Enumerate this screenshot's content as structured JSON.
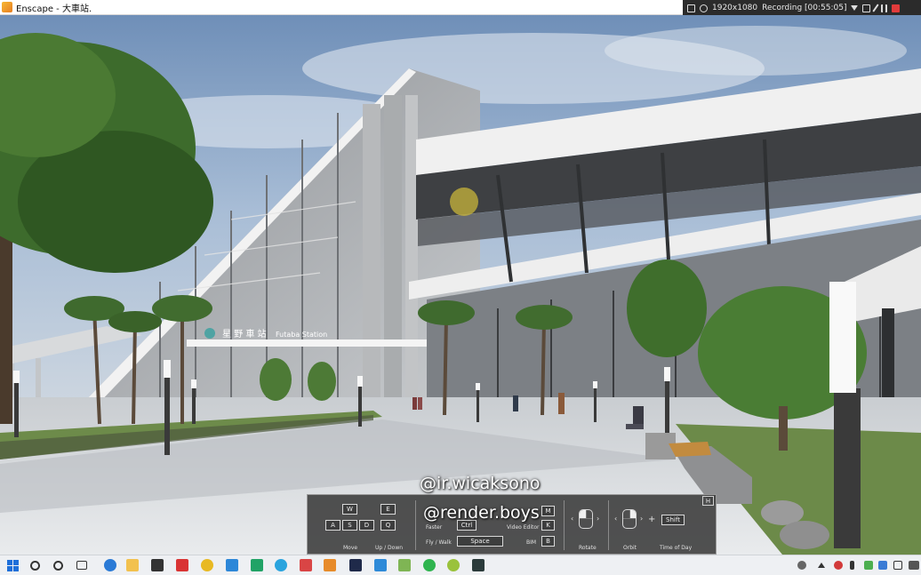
{
  "window": {
    "title": "Enscape - 大車站.",
    "icon": "enscape-logo-icon"
  },
  "recorder": {
    "resolution": "1920x1080",
    "status": "Recording [00:55:05]"
  },
  "scene": {
    "sign_text": "星 野 車 站",
    "sign_subtext": "Futaba Station"
  },
  "watermarks": [
    "@ir.wicaksono",
    "@render.boys"
  ],
  "navigation_help": {
    "keys": {
      "w": "W",
      "a": "A",
      "s": "S",
      "d": "D",
      "e": "E",
      "q": "Q",
      "ctrl": "Ctrl",
      "space": "Space",
      "m": "M",
      "k": "K",
      "b": "B",
      "shift": "Shift",
      "help": "H"
    },
    "labels": {
      "move": "Move",
      "up_down": "Up / Down",
      "faster": "Faster",
      "fly_walk": "Fly / Walk",
      "video_editor": "Video Editor",
      "bim": "BIM",
      "rotate": "Rotate",
      "orbit": "Orbit",
      "time_of_day": "Time of Day",
      "plus": "+"
    }
  },
  "taskbar": {
    "apps": [
      "search-icon",
      "cortana-icon",
      "task-view-icon",
      "edge-icon",
      "file-explorer-icon",
      "store-icon",
      "acrobat-icon",
      "chrome-icon",
      "mail-icon",
      "sheets-icon",
      "telegram-icon",
      "sketchup-icon",
      "enscape-icon",
      "photoshop-icon",
      "app-icon",
      "app-icon",
      "whatsapp-icon",
      "app-icon",
      "app-icon"
    ],
    "colors": {
      "accent": "#1e6fd9"
    }
  }
}
